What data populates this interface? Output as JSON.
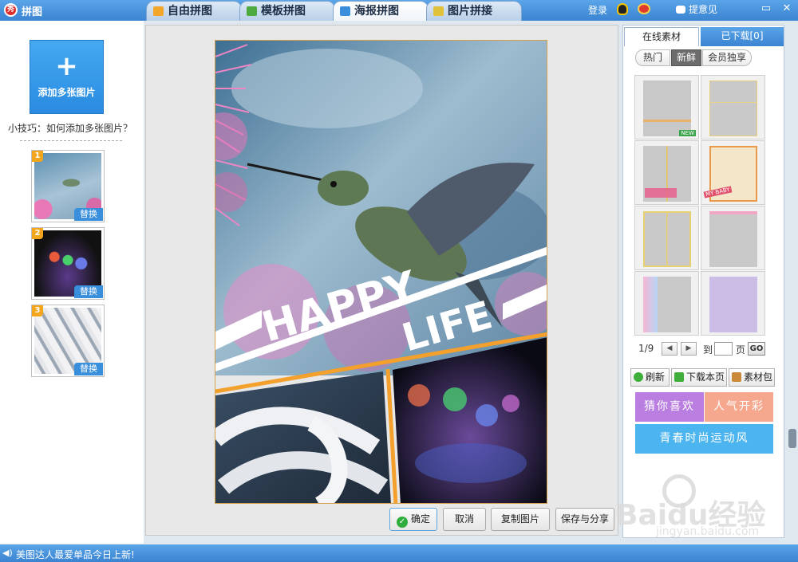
{
  "app": {
    "title": "拼图",
    "logo_text": "秀"
  },
  "tabs": [
    {
      "label": "自由拼图",
      "color": "#f2a72a"
    },
    {
      "label": "模板拼图",
      "color": "#4caa3f"
    },
    {
      "label": "海报拼图",
      "color": "#3a8fdc"
    },
    {
      "label": "图片拼接",
      "color": "#e0c23a"
    }
  ],
  "header": {
    "login": "登录",
    "feedback": "提意见",
    "win_min": "▭",
    "win_close": "✕"
  },
  "left": {
    "add_button": "添加多张图片",
    "add_plus": "+",
    "tip": "小技巧：如何添加多张图片？",
    "thumbs": [
      {
        "num": "1",
        "replace": "替换"
      },
      {
        "num": "2",
        "replace": "替换"
      },
      {
        "num": "3",
        "replace": "替换"
      }
    ]
  },
  "poster": {
    "line1": "HAPPY",
    "line2": "LIFE"
  },
  "buttons": {
    "confirm": "确定",
    "cancel": "取消",
    "copy": "复制图片",
    "save_share": "保存与分享"
  },
  "right": {
    "tab_online": "在线素材",
    "tab_downloaded": "已下载[0]",
    "filters": [
      "热门",
      "新鲜",
      "会员独享"
    ],
    "tpl_badges": {
      "new": "NEW",
      "baby": "MY BABY"
    },
    "pager": {
      "page": "1/9",
      "to": "到",
      "page_suffix": "页",
      "go": "GO",
      "prev": "◀",
      "next": "▶"
    },
    "actions": {
      "refresh": "刷新",
      "download_page": "下载本页",
      "pack": "素材包"
    },
    "categories": [
      {
        "label": "猜你喜欢",
        "color": "#b97ee0"
      },
      {
        "label": "人气开彩",
        "color": "#f5a88e"
      },
      {
        "label": "青春时尚运动风",
        "color": "#4cb4ef"
      }
    ]
  },
  "status": {
    "text": "美图达人最爱单品今日上新!",
    "speaker": "◀)"
  },
  "watermark": {
    "brand": "Baidu经验",
    "url": "jingyan.baidu.com"
  }
}
